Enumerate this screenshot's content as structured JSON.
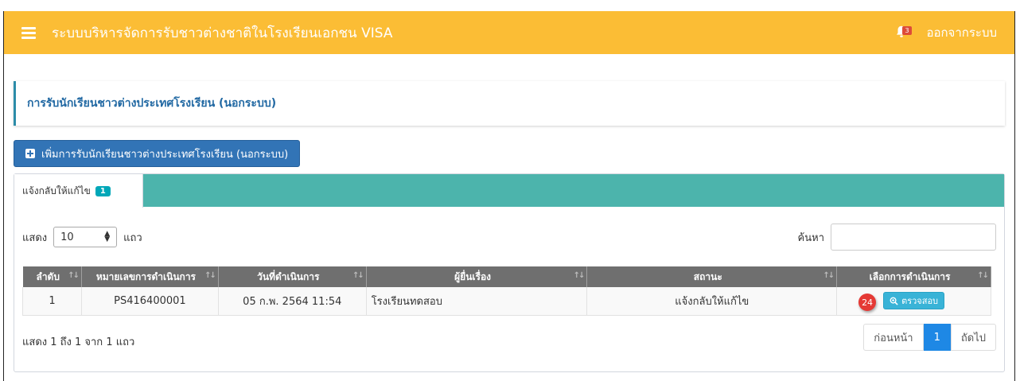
{
  "header": {
    "title": "ระบบบริหารจัดการรับชาวต่างชาติในโรงเรียนเอกชน VISA",
    "notification_count": "3",
    "logout_label": "ออกจากระบบ"
  },
  "page": {
    "title": "การรับนักเรียนชาวต่างประเทศโรงเรียน (นอกระบบ)",
    "add_button_label": "เพิ่มการรับนักเรียนชาวต่างประเทศโรงเรียน (นอกระบบ)"
  },
  "tabs": [
    {
      "label": "แจ้งกลับให้แก้ไข",
      "count": "1"
    }
  ],
  "controls": {
    "show_label": "แสดง",
    "page_size": "10",
    "rows_label": "แถว",
    "search_label": "ค้นหา",
    "search_value": ""
  },
  "table": {
    "columns": [
      "ลำดับ",
      "หมายเลขการดำเนินการ",
      "วันที่ดำเนินการ",
      "ผู้ยื่นเรื่อง",
      "สถานะ",
      "เลือกการดำเนินการ"
    ],
    "rows": [
      {
        "no": "1",
        "ref": "PS416400001",
        "date": "05 ก.พ. 2564 11:54",
        "applicant": "โรงเรียนทดสอบ",
        "status": "แจ้งกลับให้แก้ไข",
        "action_label": "ตรวจสอบ",
        "marker": "24"
      }
    ]
  },
  "footer": {
    "info": "แสดง 1 ถึง 1 จาก 1 แถว",
    "prev_label": "ก่อนหน้า",
    "current_page": "1",
    "next_label": "ถัดไป"
  },
  "colors": {
    "header_bg": "#fbbd35",
    "tab_strip": "#4cb4ac",
    "primary_button": "#3274b6",
    "check_button": "#39b3d7",
    "table_header": "#6f6f6f",
    "active_page": "#1e88e5",
    "marker": "#e53935"
  }
}
